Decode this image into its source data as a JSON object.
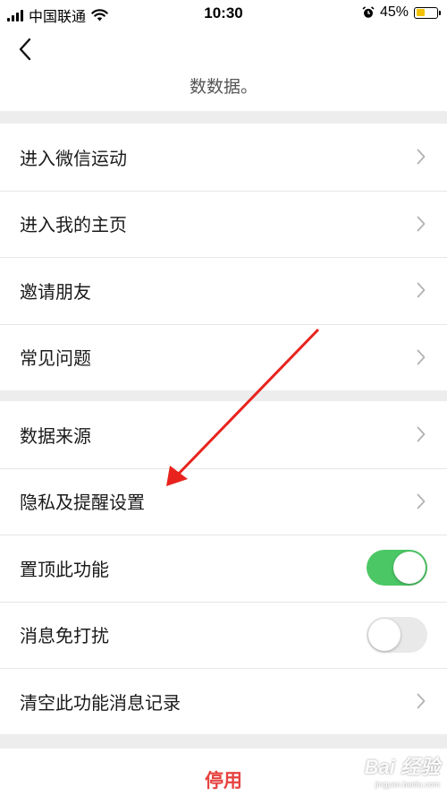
{
  "status_bar": {
    "carrier": "中国联通",
    "time": "10:30",
    "battery_percent": "45%",
    "battery_level": 0.45
  },
  "header": {
    "subtitle": "数数据。"
  },
  "group1": [
    {
      "label": "进入微信运动",
      "icon": "chevron-right-icon"
    },
    {
      "label": "进入我的主页",
      "icon": "chevron-right-icon"
    },
    {
      "label": "邀请朋友",
      "icon": "chevron-right-icon"
    },
    {
      "label": "常见问题",
      "icon": "chevron-right-icon"
    }
  ],
  "group2": [
    {
      "label": "数据来源",
      "control": "chevron"
    },
    {
      "label": "隐私及提醒设置",
      "control": "chevron"
    },
    {
      "label": "置顶此功能",
      "control": "toggle",
      "on": true
    },
    {
      "label": "消息免打扰",
      "control": "toggle",
      "on": false
    },
    {
      "label": "清空此功能消息记录",
      "control": "chevron"
    }
  ],
  "footer": {
    "disable_label": "停用"
  },
  "watermark": {
    "main": "Bai 经验",
    "sub": "jingyan.baidu.com"
  },
  "colors": {
    "toggle_on": "#4cc766",
    "toggle_off": "#e9e9ea",
    "danger": "#e64340",
    "annotation_arrow": "#e8231d",
    "section_gap": "#ededed"
  }
}
